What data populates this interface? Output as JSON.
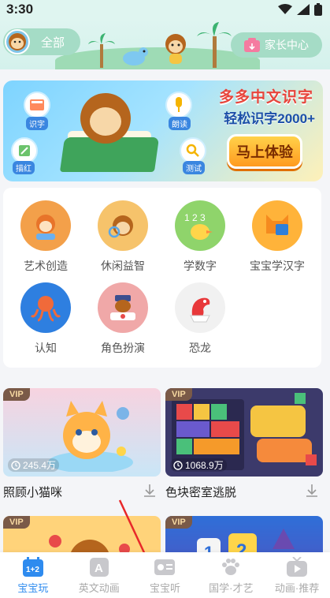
{
  "status": {
    "time": "3:30"
  },
  "header": {
    "user_label": "全部",
    "parent_label": "家长中心"
  },
  "banner": {
    "title_line1": "多多中文识字",
    "title_line2": "轻松识字2000+",
    "cta_label": "马上体验",
    "features": [
      {
        "label": "识字",
        "icon": "book-icon"
      },
      {
        "label": "朗读",
        "icon": "microphone-icon"
      },
      {
        "label": "描红",
        "icon": "pencil-icon"
      },
      {
        "label": "测试",
        "icon": "magnifier-icon"
      }
    ]
  },
  "categories": [
    {
      "label": "艺术创造",
      "color": "#f3a04a",
      "icon": "art-icon"
    },
    {
      "label": "休闲益智",
      "color": "#f6c36b",
      "icon": "puzzle-icon"
    },
    {
      "label": "学数字",
      "color": "#8fd46b",
      "icon": "numbers-icon"
    },
    {
      "label": "宝宝学汉字",
      "color": "#ffb33a",
      "icon": "chinese-character-icon"
    },
    {
      "label": "认知",
      "color": "#2e7fe0",
      "icon": "octopus-icon"
    },
    {
      "label": "角色扮演",
      "color": "#f0a8a8",
      "icon": "police-icon"
    },
    {
      "label": "恐龙",
      "color": "#f1f1f1",
      "icon": "dinosaur-icon"
    }
  ],
  "content": [
    {
      "badge": "VIP",
      "plays": "245.4万",
      "title": "照顾小猫咪",
      "color": "#f4c9d8"
    },
    {
      "badge": "VIP",
      "plays": "1068.9万",
      "title": "色块密室逃脱",
      "color": "#3c3a6b"
    },
    {
      "badge": "VIP",
      "plays": "",
      "title": "",
      "color": "#ffd37a"
    },
    {
      "badge": "VIP",
      "plays": "",
      "title": "",
      "color": "#3b86e0"
    }
  ],
  "nav": [
    {
      "label": "宝宝玩",
      "icon": "play-calendar-icon",
      "active": true
    },
    {
      "label": "英文动画",
      "icon": "letter-a-icon",
      "active": false
    },
    {
      "label": "宝宝听",
      "icon": "listen-icon",
      "active": false
    },
    {
      "label": "国学·才艺",
      "icon": "paw-icon",
      "active": false
    },
    {
      "label": "动画·推荐",
      "icon": "tv-icon",
      "active": false
    }
  ],
  "colors": {
    "accent": "#2e8bef",
    "header_bg": "#dff5f0",
    "pill": "#a5dcc6"
  }
}
